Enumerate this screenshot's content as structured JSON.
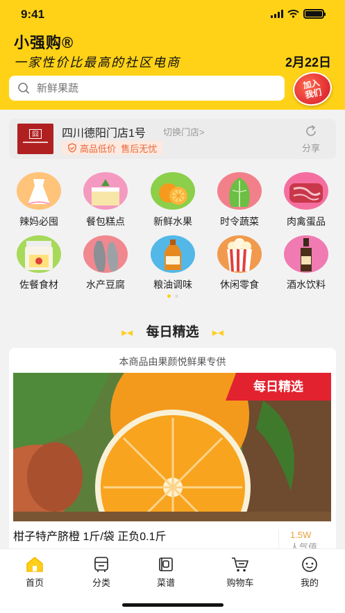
{
  "status": {
    "time": "9:41"
  },
  "header": {
    "app_title": "小强购®",
    "slogan": "一家性价比最高的社区电商",
    "date": "2月22日",
    "join_badge": "加入\n我们",
    "join_line1": "加入",
    "join_line2": "我们"
  },
  "search": {
    "placeholder": "新鲜果蔬"
  },
  "store": {
    "name": "四川德阳门店1号",
    "switch_label": "切换门店>",
    "promise": "高品低价  售后无忧",
    "share_label": "分享"
  },
  "categories": [
    {
      "label": "辣妈必囤",
      "icon": "dress-icon",
      "color": "#ffc37a"
    },
    {
      "label": "餐包糕点",
      "icon": "cake-icon",
      "color": "#f49ac0"
    },
    {
      "label": "新鲜水果",
      "icon": "orange-icon",
      "color": "#8bcf4a"
    },
    {
      "label": "时令蔬菜",
      "icon": "cabbage-icon",
      "color": "#f2808a"
    },
    {
      "label": "肉禽蛋品",
      "icon": "meat-icon",
      "color": "#f46fa0"
    },
    {
      "label": "佐餐食材",
      "icon": "jar-icon",
      "color": "#a7d95a"
    },
    {
      "label": "水产豆腐",
      "icon": "fish-icon",
      "color": "#f1888f"
    },
    {
      "label": "粮油调味",
      "icon": "oil-icon",
      "color": "#53b8e8"
    },
    {
      "label": "休闲零食",
      "icon": "popcorn-icon",
      "color": "#f19a4d"
    },
    {
      "label": "酒水饮料",
      "icon": "bottle-icon",
      "color": "#f07ab2"
    }
  ],
  "pager": {
    "pages": 2,
    "current": 1
  },
  "daily": {
    "section_title": "每日精选",
    "supplier_note": "本商品由果颜悦鲜果专供",
    "badge": "每日精选",
    "product_title": "柑子特产脐橙 1斤/袋 正负0.1斤",
    "weight": "1.5W",
    "weight_label": "人气值"
  },
  "tabs": [
    {
      "label": "首页",
      "icon": "home-icon",
      "active": true
    },
    {
      "label": "分类",
      "icon": "category-icon",
      "active": false
    },
    {
      "label": "菜谱",
      "icon": "recipe-icon",
      "active": false
    },
    {
      "label": "购物车",
      "icon": "cart-icon",
      "active": false
    },
    {
      "label": "我的",
      "icon": "profile-icon",
      "active": false
    }
  ],
  "colors": {
    "brand": "#ffd217",
    "accent_red": "#e3222f",
    "promise": "#e8683c"
  }
}
